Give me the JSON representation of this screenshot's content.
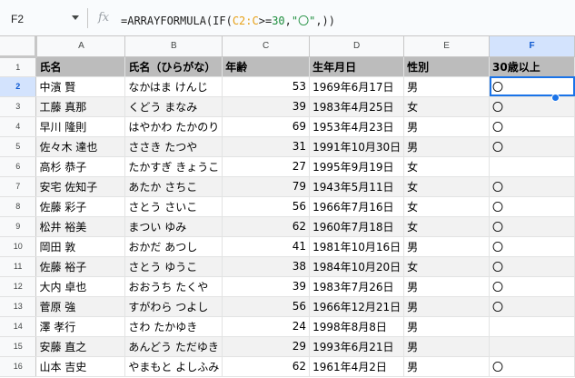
{
  "formula_bar": {
    "name_box": "F2",
    "fx_label": "fx",
    "formula": {
      "prefix": "=ARRAYFORMULA(IF(",
      "ref": "C2:C",
      "op": ">=",
      "num": "30",
      "comma": ",",
      "str": "\"〇\"",
      "suffix": ",))"
    }
  },
  "columns": [
    "A",
    "B",
    "C",
    "D",
    "E",
    "F"
  ],
  "header_row": {
    "row_num": "1",
    "cells": [
      "氏名",
      "氏名（ひらがな）",
      "年齢",
      "生年月日",
      "性別",
      "30歳以上"
    ]
  },
  "rows": [
    {
      "n": "2",
      "name": "中濱 賢",
      "kana": "なかはま けんじ",
      "age": "53",
      "dob": "1969年6月17日",
      "sex": "男",
      "flag": "〇"
    },
    {
      "n": "3",
      "name": "工藤 真那",
      "kana": "くどう まなみ",
      "age": "39",
      "dob": "1983年4月25日",
      "sex": "女",
      "flag": "〇"
    },
    {
      "n": "4",
      "name": "早川 隆則",
      "kana": "はやかわ たかのり",
      "age": "69",
      "dob": "1953年4月23日",
      "sex": "男",
      "flag": "〇"
    },
    {
      "n": "5",
      "name": "佐々木 達也",
      "kana": "ささき たつや",
      "age": "31",
      "dob": "1991年10月30日",
      "sex": "男",
      "flag": "〇"
    },
    {
      "n": "6",
      "name": "高杉 恭子",
      "kana": "たかすぎ きょうこ",
      "age": "27",
      "dob": "1995年9月19日",
      "sex": "女",
      "flag": ""
    },
    {
      "n": "7",
      "name": "安宅 佐知子",
      "kana": "あたか さちこ",
      "age": "79",
      "dob": "1943年5月11日",
      "sex": "女",
      "flag": "〇"
    },
    {
      "n": "8",
      "name": "佐藤 彩子",
      "kana": "さとう さいこ",
      "age": "56",
      "dob": "1966年7月16日",
      "sex": "女",
      "flag": "〇"
    },
    {
      "n": "9",
      "name": "松井 裕美",
      "kana": "まつい ゆみ",
      "age": "62",
      "dob": "1960年7月18日",
      "sex": "女",
      "flag": "〇"
    },
    {
      "n": "10",
      "name": "岡田 敦",
      "kana": "おかだ あつし",
      "age": "41",
      "dob": "1981年10月16日",
      "sex": "男",
      "flag": "〇"
    },
    {
      "n": "11",
      "name": "佐藤 裕子",
      "kana": "さとう ゆうこ",
      "age": "38",
      "dob": "1984年10月20日",
      "sex": "女",
      "flag": "〇"
    },
    {
      "n": "12",
      "name": "大内 卓也",
      "kana": "おおうち たくや",
      "age": "39",
      "dob": "1983年7月26日",
      "sex": "男",
      "flag": "〇"
    },
    {
      "n": "13",
      "name": "菅原 強",
      "kana": "すがわら つよし",
      "age": "56",
      "dob": "1966年12月21日",
      "sex": "男",
      "flag": "〇"
    },
    {
      "n": "14",
      "name": "澤 孝行",
      "kana": "さわ たかゆき",
      "age": "24",
      "dob": "1998年8月8日",
      "sex": "男",
      "flag": ""
    },
    {
      "n": "15",
      "name": "安藤 直之",
      "kana": "あんどう ただゆき",
      "age": "29",
      "dob": "1993年6月21日",
      "sex": "男",
      "flag": ""
    },
    {
      "n": "16",
      "name": "山本 吉史",
      "kana": "やまもと よしふみ",
      "age": "62",
      "dob": "1961年4月2日",
      "sex": "男",
      "flag": "〇"
    }
  ],
  "selection": {
    "cell": "F2",
    "accent_color": "#1a73e8",
    "header_highlight": "#d3e3fd"
  }
}
